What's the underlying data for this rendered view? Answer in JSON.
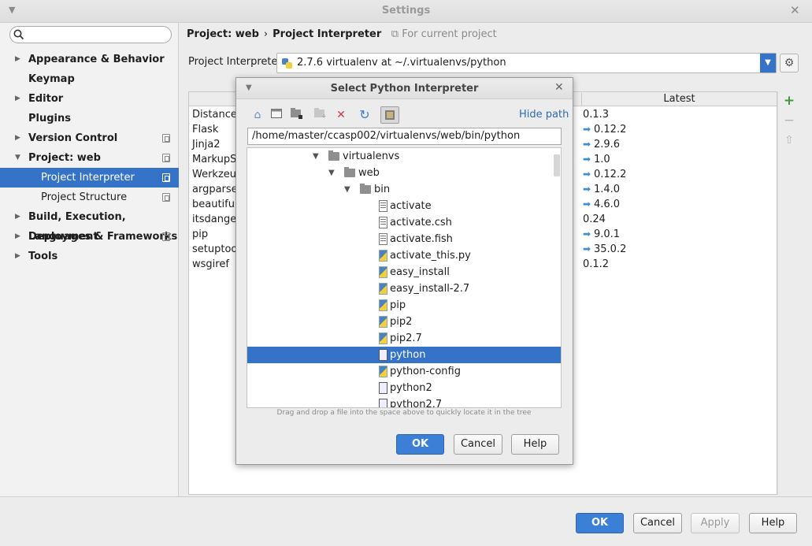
{
  "window": {
    "title": "Settings"
  },
  "sidebar": {
    "search_placeholder": "",
    "items": [
      {
        "label": "Appearance & Behavior",
        "expandable": true,
        "copy": false,
        "sub": false
      },
      {
        "label": "Keymap",
        "expandable": false,
        "copy": false,
        "sub": false
      },
      {
        "label": "Editor",
        "expandable": true,
        "copy": false,
        "sub": false
      },
      {
        "label": "Plugins",
        "expandable": false,
        "copy": false,
        "sub": false
      },
      {
        "label": "Version Control",
        "expandable": true,
        "copy": true,
        "sub": false
      },
      {
        "label": "Project: web",
        "expandable": true,
        "expanded": true,
        "copy": true,
        "sub": false
      },
      {
        "label": "Project Interpreter",
        "expandable": false,
        "copy": true,
        "sub": true,
        "selected": true
      },
      {
        "label": "Project Structure",
        "expandable": false,
        "copy": true,
        "sub": true
      },
      {
        "label": "Build, Execution, Deployment",
        "expandable": true,
        "copy": false,
        "sub": false
      },
      {
        "label": "Languages & Frameworks",
        "expandable": true,
        "copy": true,
        "sub": false
      },
      {
        "label": "Tools",
        "expandable": true,
        "copy": false,
        "sub": false
      }
    ]
  },
  "breadcrumb": {
    "parent": "Project: web",
    "sep": "›",
    "current": "Project Interpreter",
    "hint": "For current project"
  },
  "interpreter": {
    "label": "Project Interpreter:",
    "value": "2.7.6 virtualenv at ~/.virtualenvs/python"
  },
  "packages": {
    "latest_header": "Latest",
    "rows": [
      {
        "name": "Distance",
        "latest": "0.1.3",
        "upgrade": false
      },
      {
        "name": "Flask",
        "latest": "0.12.2",
        "upgrade": true
      },
      {
        "name": "Jinja2",
        "latest": "2.9.6",
        "upgrade": true
      },
      {
        "name": "MarkupSa",
        "latest": "1.0",
        "upgrade": true
      },
      {
        "name": "Werkzeug",
        "latest": "0.12.2",
        "upgrade": true
      },
      {
        "name": "argparse",
        "latest": "1.4.0",
        "upgrade": true
      },
      {
        "name": "beautiful",
        "latest": "4.6.0",
        "upgrade": true
      },
      {
        "name": "itsdanger",
        "latest": "0.24",
        "upgrade": false
      },
      {
        "name": "pip",
        "latest": "9.0.1",
        "upgrade": true
      },
      {
        "name": "setuptool",
        "latest": "35.0.2",
        "upgrade": true
      },
      {
        "name": "wsgiref",
        "latest": "0.1.2",
        "upgrade": false
      }
    ]
  },
  "side_buttons": {
    "add": "+",
    "remove": "−",
    "upgrade": "⇧"
  },
  "footer": {
    "ok": "OK",
    "cancel": "Cancel",
    "apply": "Apply",
    "help": "Help"
  },
  "dialog": {
    "title": "Select Python Interpreter",
    "hide_path": "Hide path",
    "path": "/home/master/ccasp002/virtualenvs/web/bin/python",
    "dnd_hint": "Drag and drop a file into the space above to quickly locate it in the tree",
    "ok": "OK",
    "cancel": "Cancel",
    "help": "Help",
    "tree": [
      {
        "label": "virtualenvs",
        "kind": "folder",
        "depth": 0,
        "expanded": true
      },
      {
        "label": "web",
        "kind": "folder",
        "depth": 1,
        "expanded": true
      },
      {
        "label": "bin",
        "kind": "folder",
        "depth": 2,
        "expanded": true
      },
      {
        "label": "activate",
        "kind": "txt",
        "depth": 3
      },
      {
        "label": "activate.csh",
        "kind": "txt",
        "depth": 3
      },
      {
        "label": "activate.fish",
        "kind": "txt",
        "depth": 3
      },
      {
        "label": "activate_this.py",
        "kind": "py",
        "depth": 3
      },
      {
        "label": "easy_install",
        "kind": "py",
        "depth": 3
      },
      {
        "label": "easy_install-2.7",
        "kind": "py",
        "depth": 3
      },
      {
        "label": "pip",
        "kind": "py",
        "depth": 3
      },
      {
        "label": "pip2",
        "kind": "py",
        "depth": 3
      },
      {
        "label": "pip2.7",
        "kind": "py",
        "depth": 3
      },
      {
        "label": "python",
        "kind": "bin",
        "depth": 3,
        "selected": true
      },
      {
        "label": "python-config",
        "kind": "py",
        "depth": 3
      },
      {
        "label": "python2",
        "kind": "bin",
        "depth": 3
      },
      {
        "label": "python2.7",
        "kind": "bin",
        "depth": 3
      }
    ]
  },
  "colors": {
    "accent": "#3573c8",
    "primary_button": "#3b7fd6",
    "link": "#2d6ab3",
    "add_green": "#3c9a3c",
    "upgrade_arrow": "#3f8fc8"
  }
}
